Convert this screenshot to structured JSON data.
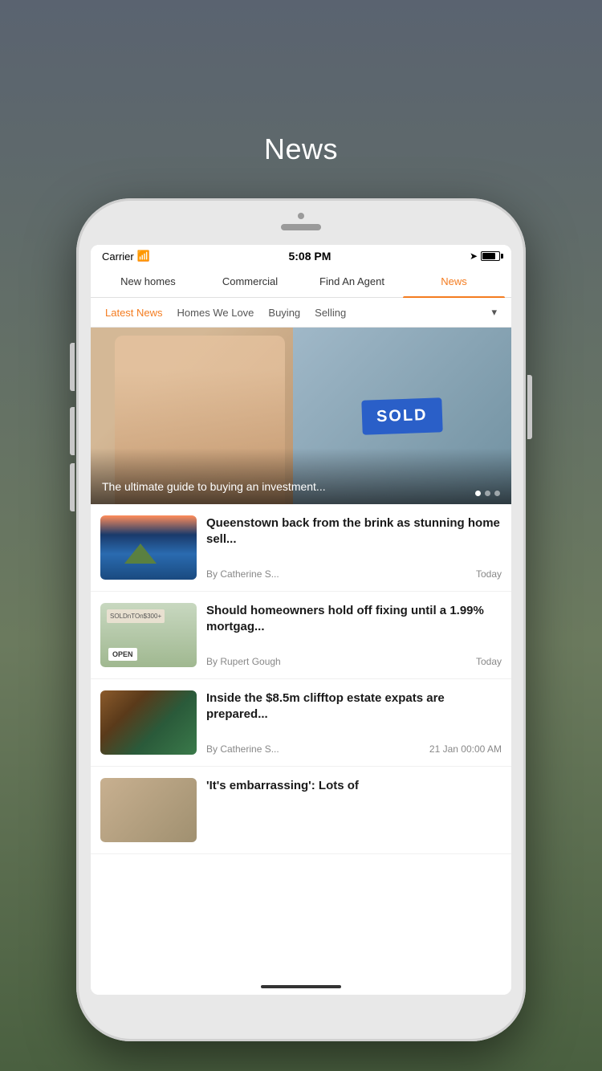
{
  "background": {
    "gradient": "dark gray to green"
  },
  "page_title": "News",
  "phone": {
    "status_bar": {
      "carrier": "Carrier",
      "time": "5:08 PM",
      "battery": "80"
    },
    "nav_tabs": [
      {
        "id": "new-homes",
        "label": "New homes",
        "active": false
      },
      {
        "id": "commercial",
        "label": "Commercial",
        "active": false
      },
      {
        "id": "find-an-agent",
        "label": "Find An Agent",
        "active": false
      },
      {
        "id": "news",
        "label": "News",
        "active": true
      }
    ],
    "category_tabs": [
      {
        "id": "latest-news",
        "label": "Latest News",
        "active": true
      },
      {
        "id": "homes-we-love",
        "label": "Homes We Love",
        "active": false
      },
      {
        "id": "buying",
        "label": "Buying",
        "active": false
      },
      {
        "id": "selling",
        "label": "Selling",
        "active": false
      },
      {
        "id": "more",
        "label": "▾",
        "active": false
      }
    ],
    "hero": {
      "caption": "The ultimate guide to buying an investment...",
      "dots": [
        {
          "active": true
        },
        {
          "active": false
        },
        {
          "active": false
        }
      ]
    },
    "news_items": [
      {
        "id": "queenstown",
        "title": "Queenstown back from the brink as stunning home sell...",
        "author": "By Catherine S...",
        "date": "Today",
        "thumb_type": "queenstown"
      },
      {
        "id": "mortgage",
        "title": "Should homeowners hold off fixing until a 1.99% mortgag...",
        "author": "By Rupert Gough",
        "date": "Today",
        "thumb_type": "mortgage"
      },
      {
        "id": "estate",
        "title": "Inside the $8.5m clifftop estate expats are prepared...",
        "author": "By Catherine S...",
        "date": "21 Jan 00:00 AM",
        "thumb_type": "estate"
      },
      {
        "id": "embarrassing",
        "title": "'It's embarrassing': Lots of",
        "author": "",
        "date": "",
        "thumb_type": "embarrassing"
      }
    ]
  }
}
